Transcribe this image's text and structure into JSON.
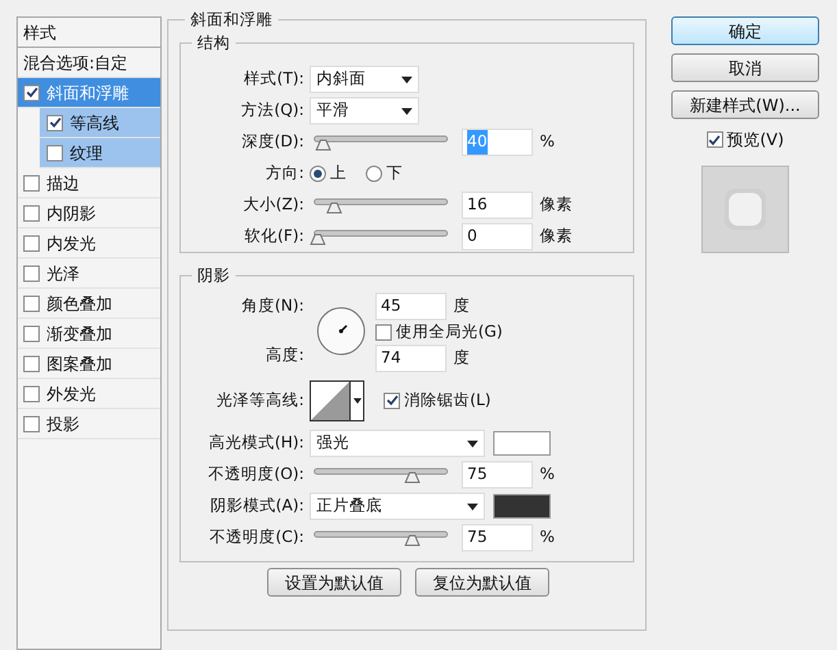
{
  "sidebar": {
    "header": "样式",
    "items": [
      {
        "label": "混合选项:自定",
        "kind": "plain",
        "selected": false
      },
      {
        "label": "斜面和浮雕",
        "kind": "check",
        "checked": true,
        "selected": true,
        "children": [
          {
            "label": "等高线",
            "kind": "check",
            "checked": true,
            "selected": false
          },
          {
            "label": "纹理",
            "kind": "check",
            "checked": false,
            "selected": false
          }
        ]
      },
      {
        "label": "描边",
        "kind": "check",
        "checked": false,
        "selected": false
      },
      {
        "label": "内阴影",
        "kind": "check",
        "checked": false,
        "selected": false
      },
      {
        "label": "内发光",
        "kind": "check",
        "checked": false,
        "selected": false
      },
      {
        "label": "光泽",
        "kind": "check",
        "checked": false,
        "selected": false
      },
      {
        "label": "颜色叠加",
        "kind": "check",
        "checked": false,
        "selected": false
      },
      {
        "label": "渐变叠加",
        "kind": "check",
        "checked": false,
        "selected": false
      },
      {
        "label": "图案叠加",
        "kind": "check",
        "checked": false,
        "selected": false
      },
      {
        "label": "外发光",
        "kind": "check",
        "checked": false,
        "selected": false
      },
      {
        "label": "投影",
        "kind": "check",
        "checked": false,
        "selected": false
      }
    ]
  },
  "panel": {
    "title": "斜面和浮雕",
    "structure": {
      "title": "结构",
      "rows": [
        {
          "kind": "select",
          "label": "样式(T):",
          "value": "内斜面"
        },
        {
          "kind": "select",
          "label": "方法(Q):",
          "value": "平滑"
        },
        {
          "kind": "slider",
          "label": "深度(D):",
          "level": 0.04,
          "value": "40",
          "value_selected": true,
          "unit": "%"
        },
        {
          "kind": "radio",
          "label": "方向:",
          "options": [
            {
              "label": "上",
              "selected": true
            },
            {
              "label": "下",
              "selected": false
            }
          ]
        },
        {
          "kind": "slider",
          "label": "大小(Z):",
          "level": 0.13,
          "value": "16",
          "value_selected": false,
          "unit": "像素"
        },
        {
          "kind": "slider",
          "label": "软化(F):",
          "level": 0,
          "value": "0",
          "value_selected": false,
          "unit": "像素"
        }
      ]
    },
    "shading": {
      "title": "阴影",
      "angle": {
        "label": "角度(N):",
        "value": "45",
        "unit": "度"
      },
      "global_light": {
        "label": "使用全局光(G)",
        "checked": false
      },
      "altitude": {
        "label": "高度:",
        "value": "74",
        "unit": "度"
      },
      "gloss_contour": {
        "label": "光泽等高线:"
      },
      "anti_aliased": {
        "label": "消除锯齿(L)",
        "checked": true
      },
      "rows": [
        {
          "kind": "mode",
          "label": "高光模式(H):",
          "value": "强光",
          "color": "#ffffff"
        },
        {
          "kind": "slider",
          "label": "不透明度(O):",
          "level": 0.75,
          "value": "75",
          "value_selected": false,
          "unit": "%"
        },
        {
          "kind": "mode",
          "label": "阴影模式(A):",
          "value": "正片叠底",
          "color": "#333333"
        },
        {
          "kind": "slider",
          "label": "不透明度(C):",
          "level": 0.75,
          "value": "75",
          "value_selected": false,
          "unit": "%"
        }
      ]
    },
    "buttons": [
      "设置为默认值",
      "复位为默认值"
    ]
  },
  "actions": [
    {
      "label": "确定",
      "default": true
    },
    {
      "label": "取消",
      "default": false
    },
    {
      "label": "新建样式(W)...",
      "default": false
    }
  ],
  "preview": {
    "label": "预览(V)",
    "checked": true
  }
}
